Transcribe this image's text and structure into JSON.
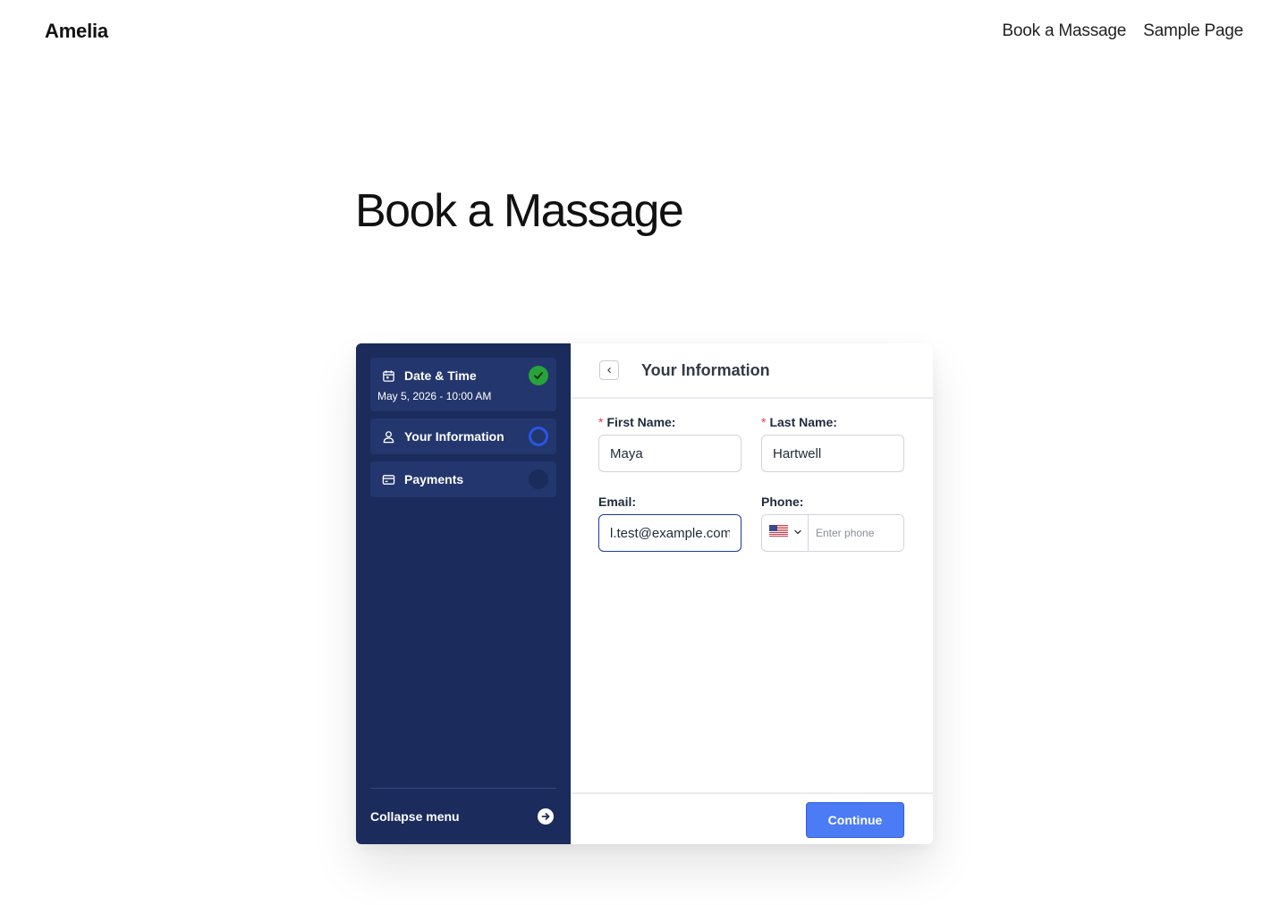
{
  "site": {
    "title": "Amelia",
    "nav": [
      "Book a Massage",
      "Sample Page"
    ]
  },
  "page": {
    "heading": "Book a Massage"
  },
  "sidebar": {
    "steps": [
      {
        "label": "Date & Time",
        "sub": "May 5, 2026 - 10:00 AM",
        "status": "completed",
        "icon": "calendar-icon"
      },
      {
        "label": "Your Information",
        "status": "current",
        "icon": "user-icon"
      },
      {
        "label": "Payments",
        "status": "pending",
        "icon": "card-icon"
      }
    ],
    "collapse_label": "Collapse menu"
  },
  "main": {
    "title": "Your Information",
    "first_name": {
      "label": "First Name:",
      "value": "Maya",
      "required": true
    },
    "last_name": {
      "label": "Last Name:",
      "value": "Hartwell",
      "required": true
    },
    "email": {
      "label": "Email:",
      "value": "l.test@example.com"
    },
    "phone": {
      "label": "Phone:",
      "placeholder": "Enter phone",
      "country": "US"
    },
    "continue_label": "Continue"
  },
  "colors": {
    "sidebar_bg": "#1a2b5c",
    "step_bg": "#23366d",
    "completed": "#27a33a",
    "current_ring": "#2857e6",
    "primary_button": "#4b7bf5"
  }
}
